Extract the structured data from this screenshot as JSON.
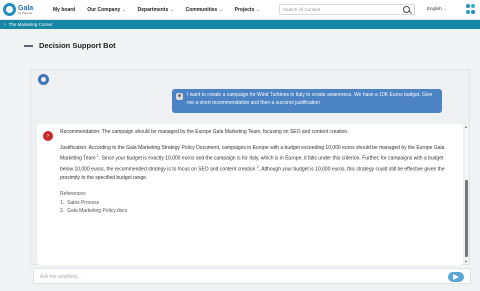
{
  "brand": {
    "name": "Gala",
    "sub": "by Plannet"
  },
  "nav": {
    "items": [
      {
        "label": "My board",
        "dropdown": false
      },
      {
        "label": "Our Company",
        "dropdown": true
      },
      {
        "label": "Departments",
        "dropdown": true
      },
      {
        "label": "Communities",
        "dropdown": true
      },
      {
        "label": "Projects",
        "dropdown": true
      }
    ],
    "search_placeholder": "Search All Content",
    "language": "English"
  },
  "breadcrumb": {
    "text": "The Marketing Corner"
  },
  "page": {
    "title": "Decision Support Bot"
  },
  "chat": {
    "user_message": "I want to create a campaign for Wind Turbines in Italy to create awareness. We have a 10K Euros budget. Give me a short recommendation and then a succinct justification",
    "bot_badge": "›",
    "bot_recommendation": "Recommendation: The campaign should be managed by the Europe Gala Marketing Team, focusing on SEO and content creation.",
    "bot_justification_1": "Justification: According to the Gala Marketing Strategy Policy Document, campaigns in Europe with a budget exceeding 10,000 euros should be managed by the Europe Gala Marketing Team",
    "bot_justification_1_ref": "1",
    "bot_justification_2": ". Since your budget is exactly 10,000 euros and the campaign is for Italy, which is in Europe, it falls under this criterion. Further, for campaigns with a budget below 10,000 euros, the recommended strategy is to focus on SEO and content creation",
    "bot_justification_2_ref": "2",
    "bot_justification_3": ". Although your budget is 10,000 euros, this strategy could still be effective given the proximity to the specified budget range.",
    "references_title": "References",
    "references": [
      {
        "num": "1.",
        "label": "Sales Process"
      },
      {
        "num": "2.",
        "label": "Gala Marketing Policy.docx"
      }
    ],
    "input_placeholder": "Ask me anything..."
  },
  "colors": {
    "accent": "#1686a5",
    "user_bubble": "#4b83c4",
    "bot_badge": "#c62a2a",
    "send_button": "#5aa6d6"
  },
  "icons": [
    "search-icon",
    "apps-grid-icon",
    "bot-avatar-icon",
    "user-avatar-icon",
    "send-icon",
    "chevron-down-icon"
  ]
}
